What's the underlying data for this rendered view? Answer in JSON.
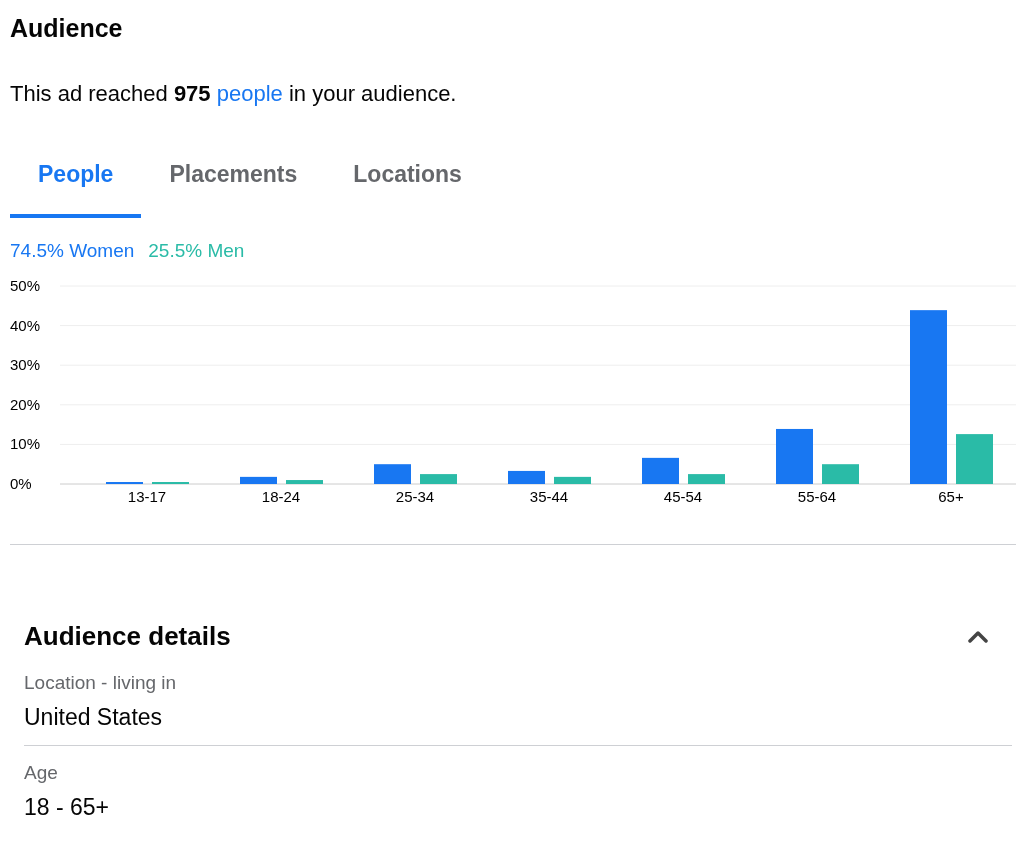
{
  "title": "Audience",
  "summary_before": "This ad reached **975**",
  "summary_link": "people",
  "summary_after": "in your audience.",
  "tabs": [
    {
      "label": "People",
      "selected": true
    },
    {
      "label": "Placements",
      "selected": false
    },
    {
      "label": "Locations",
      "selected": false
    }
  ],
  "legend_shares": [
    "74.5%",
    "25.5%"
  ],
  "chart_data": {
    "type": "bar",
    "grid": true,
    "categories": [
      "13-17",
      "18-24",
      "25-34",
      "35-44",
      "45-54",
      "55-64",
      "65+"
    ],
    "ylim": [
      0,
      50
    ],
    "yticks": [
      {
        "value": 0,
        "label": "0%"
      },
      {
        "value": 10,
        "label": "10%"
      },
      {
        "value": 20,
        "label": "20%"
      },
      {
        "value": 30,
        "label": "30%"
      },
      {
        "value": 40,
        "label": "40%"
      },
      {
        "value": 50,
        "label": "50%"
      }
    ],
    "series": [
      {
        "name": "Women",
        "color": "#1877f2",
        "values": [
          0.5,
          1.8,
          5.0,
          3.3,
          6.6,
          13.9,
          43.9
        ]
      },
      {
        "name": "Men",
        "color": "#2abba7",
        "values": [
          0.5,
          1.0,
          2.5,
          1.8,
          2.5,
          5.0,
          12.6
        ]
      }
    ]
  },
  "details": {
    "title": "Audience details",
    "expanded": true,
    "fields": [
      {
        "label": "Location - living in",
        "value": "United States"
      },
      {
        "label": "Age",
        "value": "18 - 65+"
      }
    ]
  }
}
